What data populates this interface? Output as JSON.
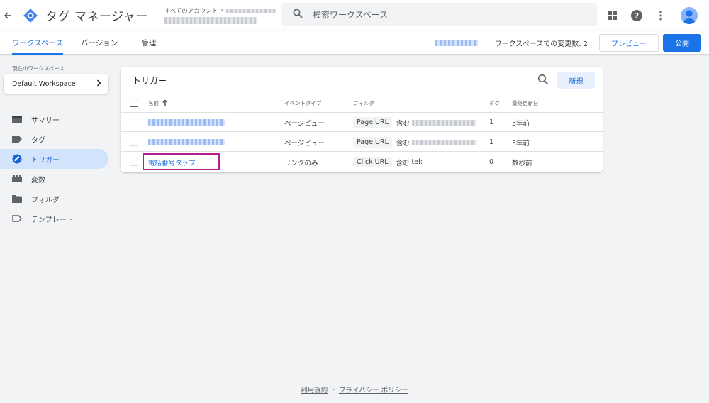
{
  "topbar": {
    "back_icon": "arrow-back-icon",
    "app_title": "タグ マネージャー",
    "accounts_link": "すべてのアカウント",
    "search_placeholder": "検索ワークスペース",
    "icons": [
      "apps-grid-icon",
      "help-icon",
      "more-vert-icon",
      "account-avatar-icon"
    ]
  },
  "subnav": {
    "tabs": [
      {
        "label": "ワークスペース",
        "active": true
      },
      {
        "label": "バージョン",
        "active": false
      },
      {
        "label": "管理",
        "active": false
      }
    ],
    "changes_text": "ワークスペースでの変更数: 2",
    "preview_label": "プレビュー",
    "publish_label": "公開"
  },
  "sidebar": {
    "workspace_label": "現在のワークスペース",
    "workspace_name": "Default Workspace",
    "items": [
      {
        "label": "サマリー",
        "icon": "folder-overview-icon",
        "active": false
      },
      {
        "label": "タグ",
        "icon": "tag-icon",
        "active": false
      },
      {
        "label": "トリガー",
        "icon": "trigger-icon",
        "active": true
      },
      {
        "label": "変数",
        "icon": "variables-icon",
        "active": false
      },
      {
        "label": "フォルダ",
        "icon": "folder-icon",
        "active": false
      },
      {
        "label": "テンプレート",
        "icon": "template-icon",
        "active": false
      }
    ]
  },
  "triggers": {
    "title": "トリガー",
    "new_label": "新規",
    "columns": {
      "name": "名前",
      "sort_icon": "arrow-upward-icon",
      "event_type": "イベントタイプ",
      "filter": "フィルタ",
      "tags": "タグ",
      "last_edited": "最終更新日"
    },
    "rows": [
      {
        "name": "",
        "event_type": "ページビュー",
        "filter_var": "Page URL",
        "filter_op": "含む",
        "filter_value": "",
        "tags": "1",
        "last_edited": "5年前"
      },
      {
        "name": "",
        "event_type": "ページビュー",
        "filter_var": "Page URL",
        "filter_op": "含む",
        "filter_value": "",
        "tags": "1",
        "last_edited": "5年前"
      },
      {
        "name": "電話番号タップ",
        "event_type": "リンクのみ",
        "filter_var": "Click URL",
        "filter_op": "含む",
        "filter_value": "tel:",
        "tags": "0",
        "last_edited": "数秒前"
      }
    ]
  },
  "footer": {
    "terms": "利用規約",
    "separator": "・",
    "privacy": "プライバシー ポリシー"
  },
  "colors": {
    "accent": "#1a73e8",
    "highlight_box": "#b41e8e",
    "active_nav_bg": "#d2e3fc"
  }
}
